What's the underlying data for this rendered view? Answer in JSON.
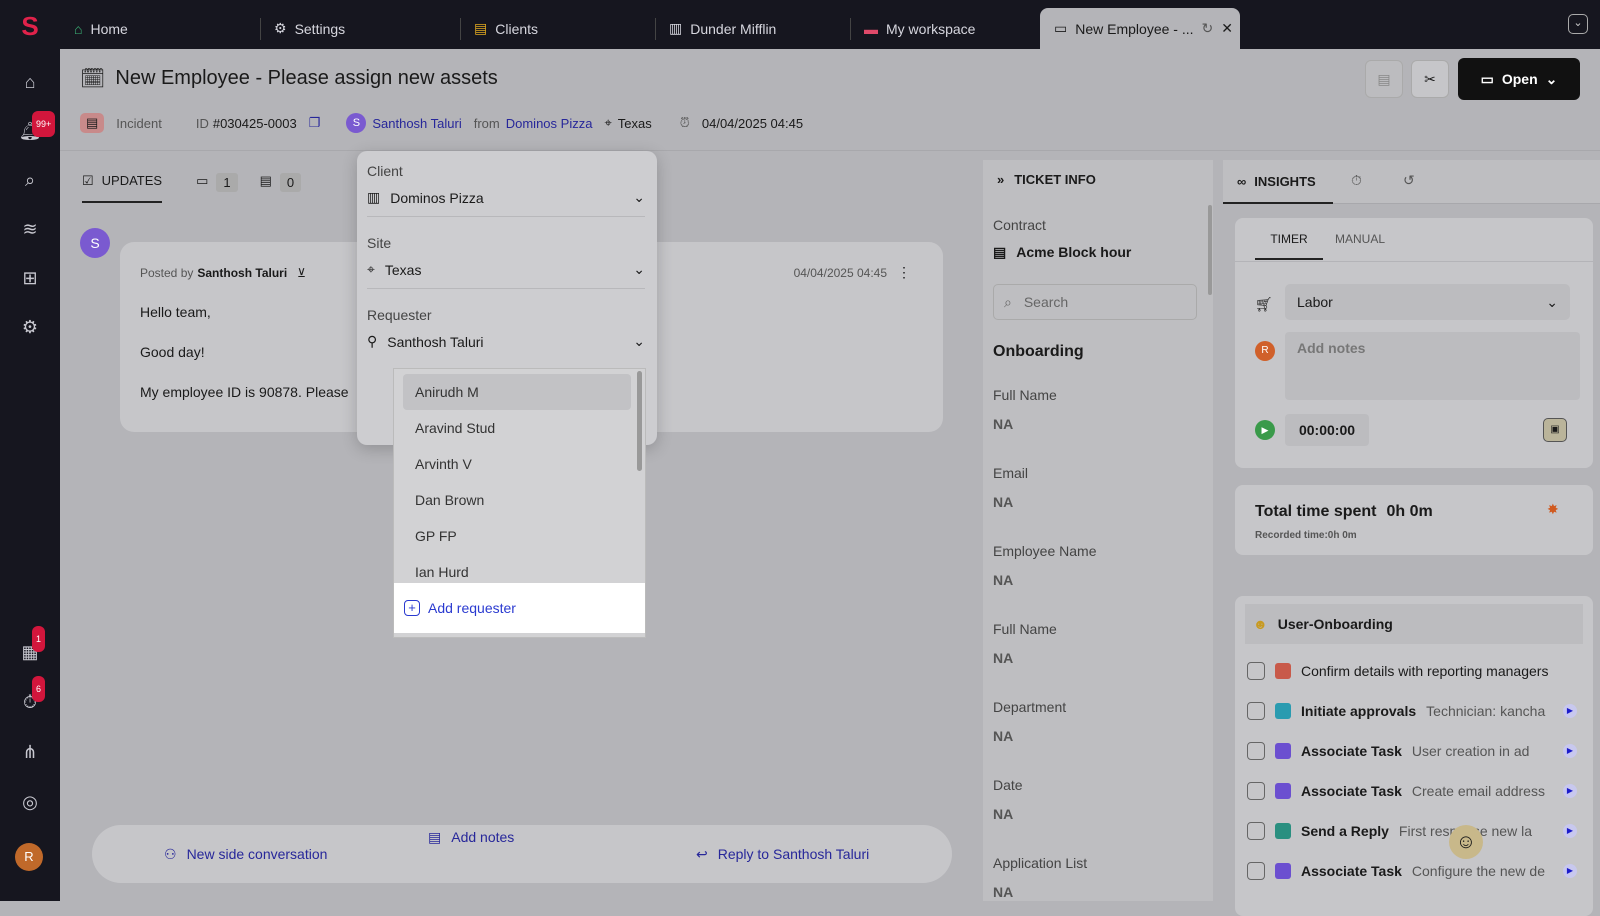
{
  "tabs": [
    {
      "label": "Home",
      "icon": "home-icon"
    },
    {
      "label": "Settings",
      "icon": "gear-icon"
    },
    {
      "label": "Clients",
      "icon": "store-icon"
    },
    {
      "label": "Dunder Mifflin",
      "icon": "building-icon"
    },
    {
      "label": "My workspace",
      "icon": "workspace-icon"
    },
    {
      "label": "New Employee - ...",
      "icon": "ticket-icon"
    }
  ],
  "sidebar": {
    "notifications_badge": "99+",
    "calendar_badge": "1",
    "timer_badge": "6",
    "avatar": "R"
  },
  "ticket": {
    "title": "New Employee - Please assign new assets",
    "type": "Incident",
    "id_label": "ID",
    "id": "#030425-0003",
    "requester_initial": "S",
    "requester": "Santhosh Taluri",
    "from": "from",
    "client": "Dominos Pizza",
    "site": "Texas",
    "datetime": "04/04/2025 04:45",
    "status_button": "Open"
  },
  "updates": {
    "tab_label": "UPDATES",
    "comments_count": "1",
    "notes_count": "0"
  },
  "post": {
    "posted_by": "Posted by",
    "author": "Santhosh Taluri",
    "author_initial": "S",
    "time": "04/04/2025 04:45",
    "lines": [
      "Hello team,",
      "Good day!",
      "My employee ID is 90878. Please"
    ]
  },
  "popup": {
    "client_label": "Client",
    "client_value": "Dominos Pizza",
    "site_label": "Site",
    "site_value": "Texas",
    "requester_label": "Requester",
    "requester_value": "Santhosh Taluri",
    "options": [
      "Anirudh M",
      "Aravind Stud",
      "Arvinth V",
      "Dan Brown",
      "GP FP",
      "Ian Hurd"
    ],
    "add_requester": "Add requester"
  },
  "bottom": {
    "side_conversation": "New side conversation",
    "add_notes": "Add notes",
    "reply": "Reply to Santhosh Taluri"
  },
  "ticket_info": {
    "header": "TICKET INFO",
    "contract_label": "Contract",
    "contract_value": "Acme Block hour",
    "search_placeholder": "Search",
    "section": "Onboarding",
    "fields": [
      {
        "label": "Full Name",
        "value": "NA"
      },
      {
        "label": "Email",
        "value": "NA"
      },
      {
        "label": "Employee Name",
        "value": "NA"
      },
      {
        "label": "Full Name",
        "value": "NA"
      },
      {
        "label": "Department",
        "value": "NA"
      },
      {
        "label": "Date",
        "value": "NA"
      },
      {
        "label": "Application List",
        "value": "NA"
      }
    ]
  },
  "insights": {
    "tab_label": "INSIGHTS",
    "timer_tab": "TIMER",
    "manual_tab": "MANUAL",
    "work_type": "Labor",
    "notes_placeholder": "Add notes",
    "user_initial": "R",
    "timer": "00:00:00",
    "total_label": "Total time spent",
    "total_value": "0h 0m",
    "recorded": "Recorded time:0h 0m",
    "checklist_title": "User-Onboarding",
    "tasks": [
      {
        "title": "Confirm details with reporting managers",
        "detail": "",
        "color": "#c85a4a",
        "bold": false
      },
      {
        "title": "Initiate approvals",
        "detail": "Technician: kancha",
        "color": "#2a9bb0"
      },
      {
        "title": "Associate Task",
        "detail": "User creation in ad",
        "color": "#6b4fd0"
      },
      {
        "title": "Associate Task",
        "detail": "Create email address",
        "color": "#6b4fd0"
      },
      {
        "title": "Send a Reply",
        "detail": "First response new la",
        "color": "#2a8f80"
      },
      {
        "title": "Associate Task",
        "detail": "Configure the new de",
        "color": "#6b4fd0"
      }
    ]
  }
}
